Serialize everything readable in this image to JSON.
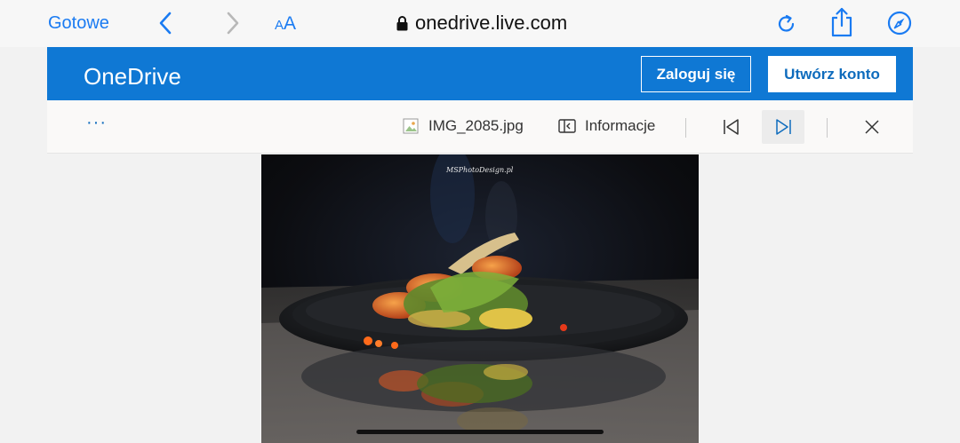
{
  "browser": {
    "done_label": "Gotowe",
    "text_size_small": "A",
    "text_size_big": "A",
    "url": "onedrive.live.com",
    "accent_color": "#1a7bf2"
  },
  "header": {
    "title": "OneDrive",
    "login_label": "Zaloguj się",
    "create_account_label": "Utwórz konto",
    "brand_color": "#0f78d4"
  },
  "toolbar": {
    "more_label": "···",
    "file_name": "IMG_2085.jpg",
    "info_label": "Informacje"
  },
  "photo": {
    "watermark": "MSPhotoDesign.pl",
    "icon": "food-photo"
  }
}
